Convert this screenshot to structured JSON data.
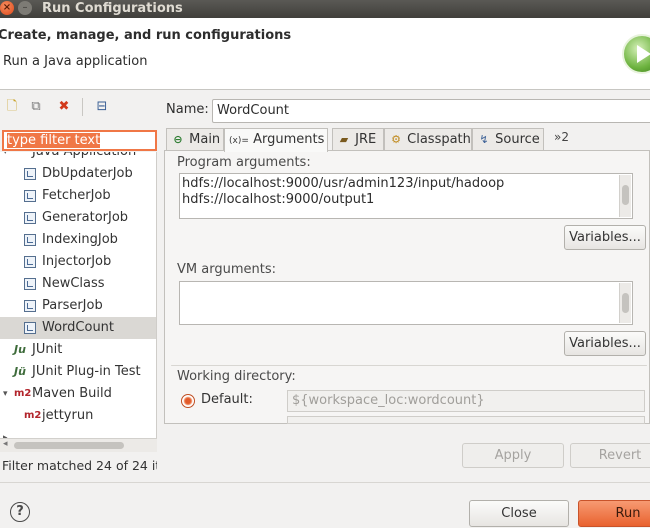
{
  "window": {
    "title": "Run Configurations"
  },
  "header": {
    "title": "Create, manage, and run configurations",
    "subtitle": "Run a Java application"
  },
  "left": {
    "filter_value": "type filter text",
    "tree": [
      {
        "label": "Java Application",
        "kind": "category"
      },
      {
        "label": "DbUpdaterJob",
        "kind": "java-config"
      },
      {
        "label": "FetcherJob",
        "kind": "java-config"
      },
      {
        "label": "GeneratorJob",
        "kind": "java-config"
      },
      {
        "label": "IndexingJob",
        "kind": "java-config"
      },
      {
        "label": "InjectorJob",
        "kind": "java-config"
      },
      {
        "label": "NewClass",
        "kind": "java-config"
      },
      {
        "label": "ParserJob",
        "kind": "java-config"
      },
      {
        "label": "WordCount",
        "kind": "java-config",
        "selected": true
      },
      {
        "label": "JUnit",
        "kind": "junit"
      },
      {
        "label": "JUnit Plug-in Test",
        "kind": "junit-plugin"
      },
      {
        "label": "Maven Build",
        "kind": "maven-category"
      },
      {
        "label": "jettyrun",
        "kind": "maven-config"
      }
    ],
    "filter_status": "Filter matched 24 of 24 it"
  },
  "right": {
    "name_label": "Name:",
    "name_value": "WordCount",
    "tabs": [
      {
        "label": "Main",
        "icon": "main-tab-icon"
      },
      {
        "label": "Arguments",
        "icon": "arguments-tab-icon",
        "active": true
      },
      {
        "label": "JRE",
        "icon": "jre-tab-icon"
      },
      {
        "label": "Classpath",
        "icon": "classpath-tab-icon"
      },
      {
        "label": "Source",
        "icon": "source-tab-icon"
      }
    ],
    "more_tabs": "»2",
    "program_args_label": "Program arguments:",
    "program_args": [
      "hdfs://localhost:9000/usr/admin123/input/hadoop",
      "hdfs://localhost:9000/output1"
    ],
    "variables_label": "Variables...",
    "vm_args_label": "VM arguments:",
    "vm_args": "",
    "working_dir_label": "Working directory:",
    "default_label": "Default:",
    "default_value": "${workspace_loc:wordcount}",
    "apply_label": "Apply",
    "revert_label": "Revert"
  },
  "footer": {
    "help": "?",
    "close_label": "Close",
    "run_label": "Run"
  }
}
